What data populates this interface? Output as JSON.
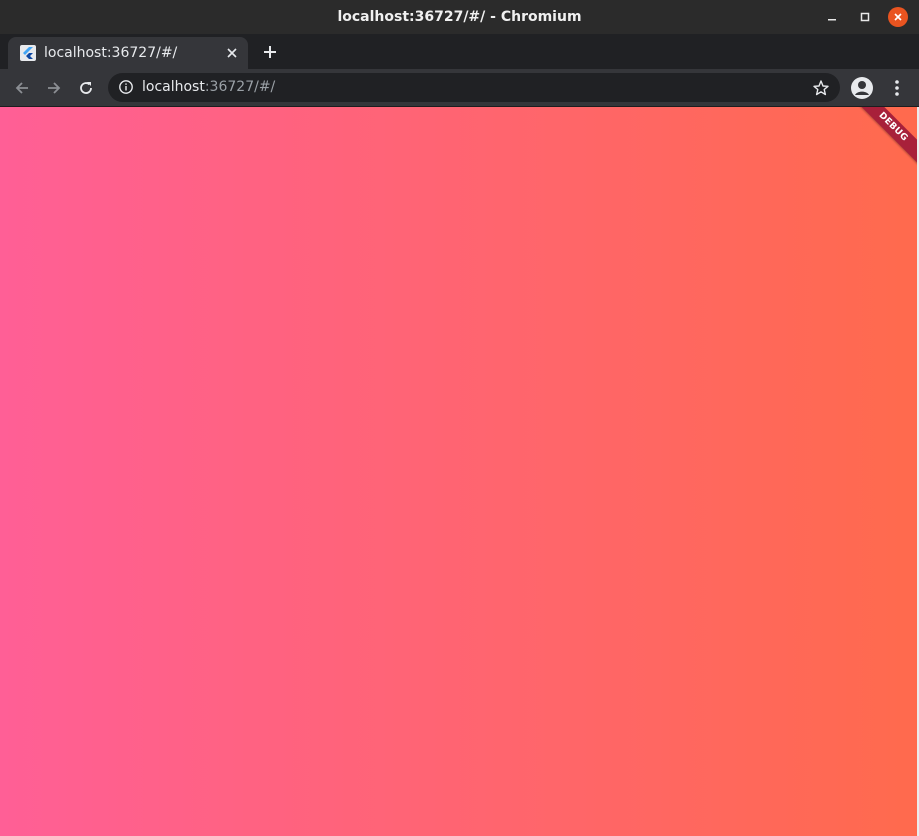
{
  "window": {
    "title": "localhost:36727/#/ - Chromium"
  },
  "tab": {
    "label": "localhost:36727/#/",
    "favicon": "flutter-icon"
  },
  "toolbar": {
    "url_host": "localhost",
    "url_rest": ":36727/#/"
  },
  "app": {
    "debug_banner": "DEBUG",
    "gradient_start": "#ff5f96",
    "gradient_end": "#ff6a4d"
  },
  "colors": {
    "close_button": "#e95420",
    "chrome_dark": "#202124",
    "chrome_toolbar": "#35363a"
  }
}
